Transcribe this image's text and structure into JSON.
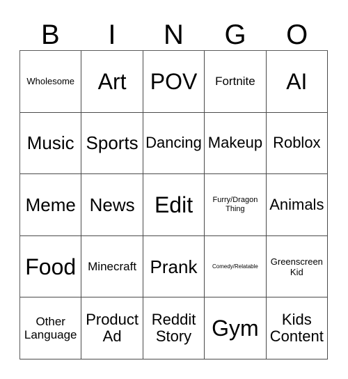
{
  "card": {
    "header_letters": [
      "B",
      "I",
      "N",
      "G",
      "O"
    ],
    "rows": [
      [
        {
          "label": "Wholesome",
          "size": "xs"
        },
        {
          "label": "Art",
          "size": "xl"
        },
        {
          "label": "POV",
          "size": "xl"
        },
        {
          "label": "Fortnite",
          "size": "sm"
        },
        {
          "label": "AI",
          "size": "xl"
        }
      ],
      [
        {
          "label": "Music",
          "size": "lg"
        },
        {
          "label": "Sports",
          "size": "lg"
        },
        {
          "label": "Dancing",
          "size": "md"
        },
        {
          "label": "Makeup",
          "size": "md"
        },
        {
          "label": "Roblox",
          "size": "md"
        }
      ],
      [
        {
          "label": "Meme",
          "size": "lg"
        },
        {
          "label": "News",
          "size": "lg"
        },
        {
          "label": "Edit",
          "size": "xl"
        },
        {
          "label": "Furry/Dragon\nThing",
          "size": "xxs"
        },
        {
          "label": "Animals",
          "size": "md"
        }
      ],
      [
        {
          "label": "Food",
          "size": "xl"
        },
        {
          "label": "Minecraft",
          "size": "sm"
        },
        {
          "label": "Prank",
          "size": "lg"
        },
        {
          "label": "Comedy/Relatable",
          "size": "tiny"
        },
        {
          "label": "Greenscreen\nKid",
          "size": "xs"
        }
      ],
      [
        {
          "label": "Other\nLanguage",
          "size": "sm"
        },
        {
          "label": "Product\nAd",
          "size": "md"
        },
        {
          "label": "Reddit\nStory",
          "size": "md"
        },
        {
          "label": "Gym",
          "size": "xl"
        },
        {
          "label": "Kids\nContent",
          "size": "md"
        }
      ]
    ]
  },
  "colors": {
    "background": "#ffffff",
    "text": "#000000",
    "grid_line": "#4a4a4a"
  }
}
